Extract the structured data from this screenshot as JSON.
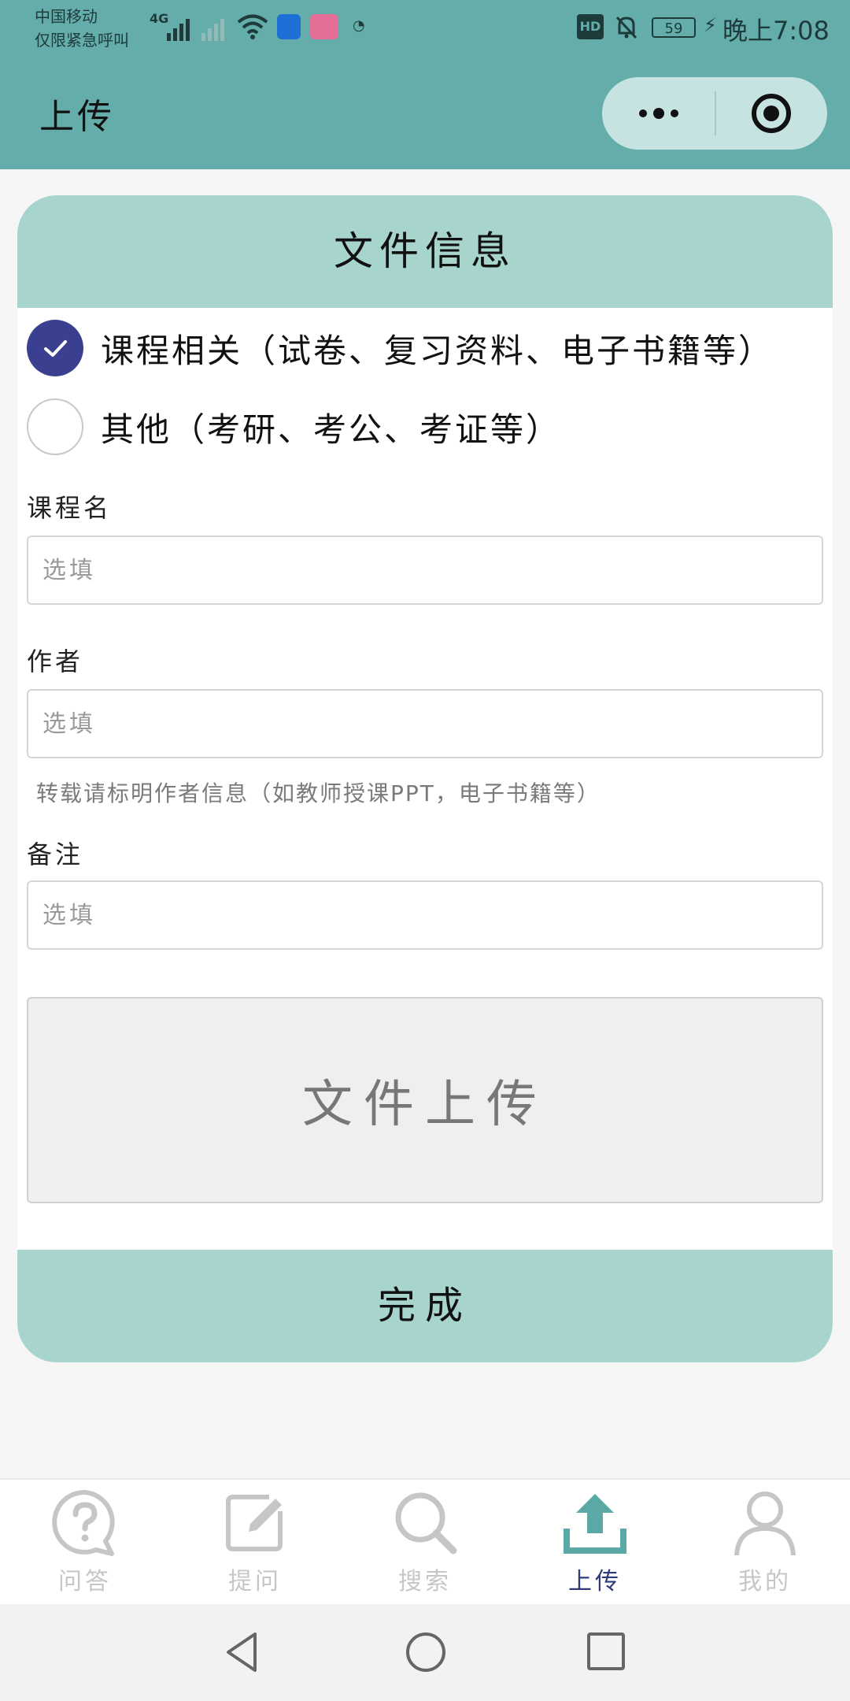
{
  "status_bar": {
    "carrier_line1": "中国移动",
    "carrier_line2": "仅限紧急呼叫",
    "network": "4G",
    "hd": "HD",
    "battery": "59",
    "time": "晚上7:08"
  },
  "nav": {
    "title": "上传"
  },
  "card": {
    "title": "文件信息",
    "options": [
      {
        "label": "课程相关（试卷、复习资料、电子书籍等）",
        "checked": true
      },
      {
        "label": "其他（考研、考公、考证等）",
        "checked": false
      }
    ],
    "fields": {
      "course": {
        "label": "课程名",
        "placeholder": "选填",
        "value": ""
      },
      "author": {
        "label": "作者",
        "placeholder": "选填",
        "value": "",
        "hint": "转载请标明作者信息（如教师授课PPT，电子书籍等）"
      },
      "note": {
        "label": "备注",
        "placeholder": "选填",
        "value": ""
      }
    },
    "upload_label": "文件上传",
    "done_label": "完成"
  },
  "tabbar": {
    "tabs": [
      {
        "label": "问答",
        "icon": "question-bubble-icon",
        "active": false
      },
      {
        "label": "提问",
        "icon": "edit-icon",
        "active": false
      },
      {
        "label": "搜索",
        "icon": "search-icon",
        "active": false
      },
      {
        "label": "上传",
        "icon": "upload-icon",
        "active": true
      },
      {
        "label": "我的",
        "icon": "profile-icon",
        "active": false
      }
    ]
  },
  "colors": {
    "header": "#64adaa",
    "accent": "#a7d4cd",
    "radio_checked": "#3b3f8f",
    "tab_active": "#2f3a7a",
    "upload_icon_active": "#5aa9a5"
  }
}
